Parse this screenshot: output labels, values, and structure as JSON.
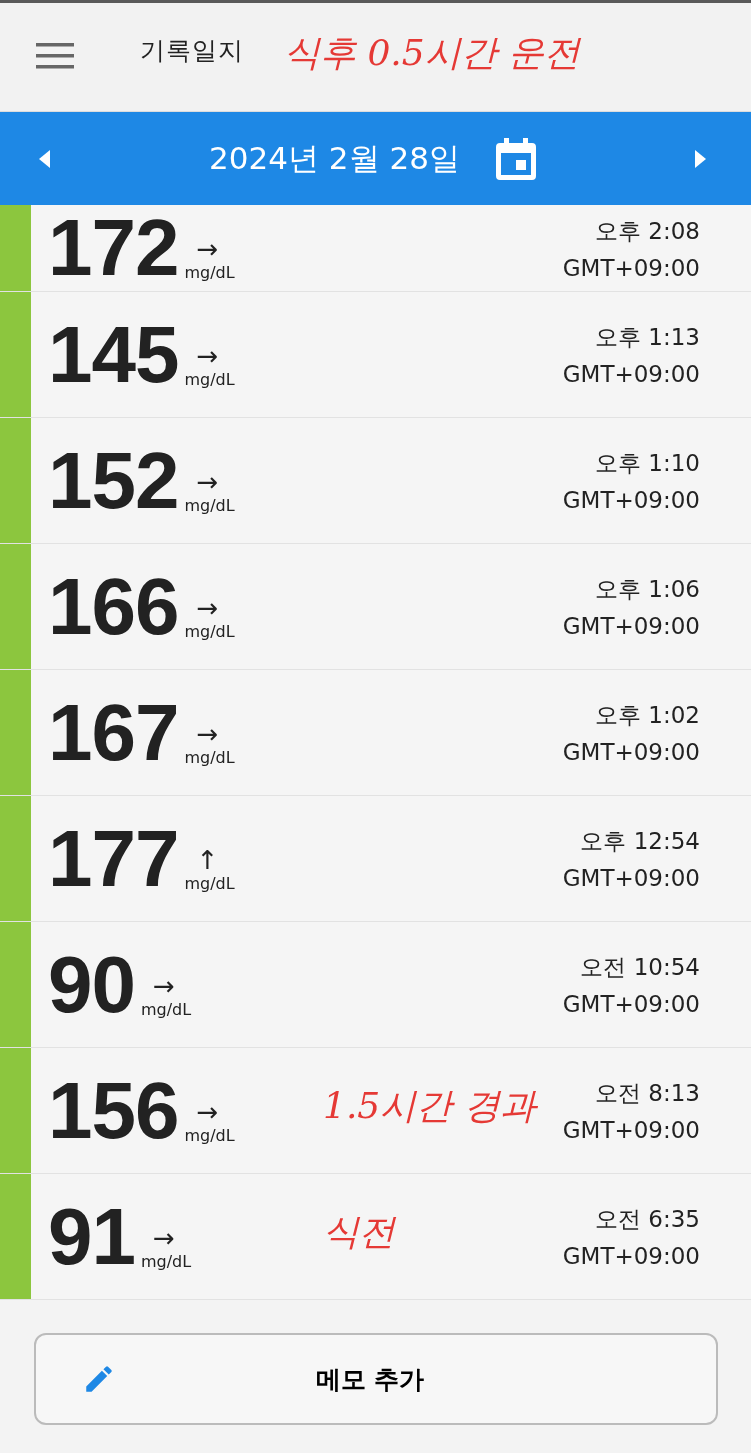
{
  "header": {
    "title": "기록일지",
    "note": "식후 0.5시간 운전"
  },
  "date_bar": {
    "date": "2024년 2월 28일"
  },
  "readings": [
    {
      "value": "172",
      "trend": "→",
      "unit": "mg/dL",
      "time": "오후 2:08",
      "zone": "GMT+09:00",
      "color": "#8cc63e"
    },
    {
      "value": "145",
      "trend": "→",
      "unit": "mg/dL",
      "time": "오후 1:13",
      "zone": "GMT+09:00",
      "color": "#8cc63e"
    },
    {
      "value": "152",
      "trend": "→",
      "unit": "mg/dL",
      "time": "오후 1:10",
      "zone": "GMT+09:00",
      "color": "#8cc63e"
    },
    {
      "value": "166",
      "trend": "→",
      "unit": "mg/dL",
      "time": "오후 1:06",
      "zone": "GMT+09:00",
      "color": "#8cc63e"
    },
    {
      "value": "167",
      "trend": "→",
      "unit": "mg/dL",
      "time": "오후 1:02",
      "zone": "GMT+09:00",
      "color": "#8cc63e"
    },
    {
      "value": "177",
      "trend": "↑",
      "unit": "mg/dL",
      "time": "오후 12:54",
      "zone": "GMT+09:00",
      "color": "#8cc63e"
    },
    {
      "value": "90",
      "trend": "→",
      "unit": "mg/dL",
      "time": "오전 10:54",
      "zone": "GMT+09:00",
      "color": "#8cc63e"
    },
    {
      "value": "156",
      "trend": "→",
      "unit": "mg/dL",
      "time": "오전 8:13",
      "zone": "GMT+09:00",
      "color": "#8cc63e",
      "note": "1.5시간 경과"
    },
    {
      "value": "91",
      "trend": "→",
      "unit": "mg/dL",
      "time": "오전 6:35",
      "zone": "GMT+09:00",
      "color": "#8cc63e",
      "note": "식전"
    }
  ],
  "add_memo_button": {
    "label": "메모 추가"
  }
}
